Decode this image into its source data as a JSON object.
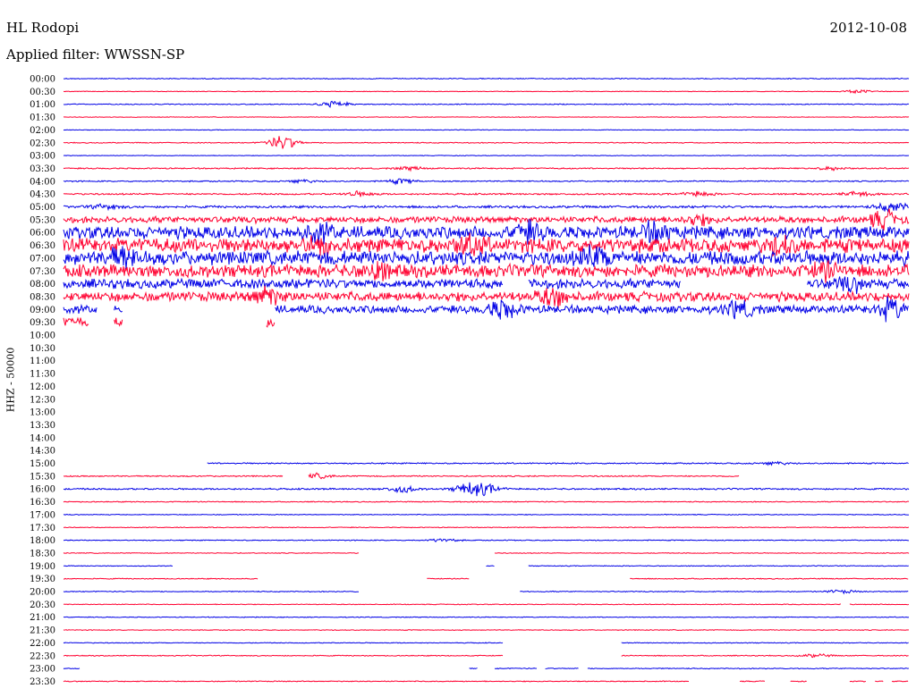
{
  "header": {
    "station": "HL Rodopi",
    "date": "2012-10-08",
    "filter": "Applied filter: WWSSN-SP"
  },
  "channel_label": "HHZ - 50000",
  "colors": {
    "odd": "#0000e6",
    "even": "#ff0030"
  },
  "chart_data": {
    "type": "line",
    "title": "HL Rodopi",
    "subtitle": "Applied filter: WWSSN-SP",
    "ylabel": "HHZ - 50000",
    "y_tick_labels": [
      "00:00",
      "00:30",
      "01:00",
      "01:30",
      "02:00",
      "02:30",
      "03:00",
      "03:30",
      "04:00",
      "04:30",
      "05:00",
      "05:30",
      "06:00",
      "06:30",
      "07:00",
      "07:30",
      "08:00",
      "08:30",
      "09:00",
      "09:30",
      "10:00",
      "10:30",
      "11:00",
      "11:30",
      "12:00",
      "12:30",
      "13:00",
      "13:30",
      "14:00",
      "14:30",
      "15:00",
      "15:30",
      "16:00",
      "16:30",
      "17:00",
      "17:30",
      "18:00",
      "18:30",
      "19:00",
      "19:30",
      "20:00",
      "20:30",
      "21:00",
      "21:30",
      "22:00",
      "22:30",
      "23:00",
      "23:30"
    ],
    "x_range_minutes": [
      0,
      30
    ],
    "series": [
      {
        "start": "00:00",
        "amplitude": 0.6,
        "segments": [
          [
            0,
            1
          ]
        ],
        "events": []
      },
      {
        "start": "00:30",
        "amplitude": 0.4,
        "segments": [
          [
            0,
            1
          ]
        ],
        "events": [
          [
            0.94,
            2
          ]
        ]
      },
      {
        "start": "01:00",
        "amplitude": 0.6,
        "segments": [
          [
            0,
            1
          ]
        ],
        "events": [
          [
            0.32,
            4
          ]
        ]
      },
      {
        "start": "01:30",
        "amplitude": 0.4,
        "segments": [
          [
            0,
            1
          ]
        ],
        "events": []
      },
      {
        "start": "02:00",
        "amplitude": 0.4,
        "segments": [
          [
            0,
            1
          ]
        ],
        "events": []
      },
      {
        "start": "02:30",
        "amplitude": 0.6,
        "segments": [
          [
            0,
            1
          ]
        ],
        "events": [
          [
            0.26,
            9
          ]
        ]
      },
      {
        "start": "03:00",
        "amplitude": 0.4,
        "segments": [
          [
            0,
            1
          ]
        ],
        "events": []
      },
      {
        "start": "03:30",
        "amplitude": 0.8,
        "segments": [
          [
            0,
            1
          ]
        ],
        "events": [
          [
            0.41,
            2
          ],
          [
            0.91,
            2
          ]
        ]
      },
      {
        "start": "04:00",
        "amplitude": 0.8,
        "segments": [
          [
            0,
            1
          ]
        ],
        "events": [
          [
            0.28,
            2
          ],
          [
            0.4,
            3
          ]
        ]
      },
      {
        "start": "04:30",
        "amplitude": 1.0,
        "segments": [
          [
            0,
            1
          ]
        ],
        "events": [
          [
            0.35,
            3
          ],
          [
            0.75,
            3
          ],
          [
            0.94,
            3
          ]
        ]
      },
      {
        "start": "05:00",
        "amplitude": 1.5,
        "segments": [
          [
            0,
            1
          ]
        ],
        "events": [
          [
            0.05,
            3
          ],
          [
            0.98,
            6
          ]
        ]
      },
      {
        "start": "05:30",
        "amplitude": 4,
        "segments": [
          [
            0,
            1
          ]
        ],
        "events": [
          [
            0.75,
            5
          ],
          [
            0.97,
            10
          ]
        ]
      },
      {
        "start": "06:00",
        "amplitude": 8,
        "segments": [
          [
            0,
            1
          ]
        ],
        "events": [
          [
            0.3,
            8
          ],
          [
            0.55,
            9
          ],
          [
            0.7,
            9
          ]
        ]
      },
      {
        "start": "06:30",
        "amplitude": 9,
        "segments": [
          [
            0,
            1
          ]
        ],
        "events": [
          [
            0.3,
            8
          ],
          [
            0.48,
            9
          ],
          [
            0.85,
            8
          ]
        ]
      },
      {
        "start": "07:00",
        "amplitude": 9,
        "segments": [
          [
            0,
            1
          ]
        ],
        "events": [
          [
            0.07,
            9
          ],
          [
            0.63,
            10
          ]
        ]
      },
      {
        "start": "07:30",
        "amplitude": 8,
        "segments": [
          [
            0,
            1
          ]
        ],
        "events": [
          [
            0.37,
            9
          ],
          [
            0.9,
            7
          ]
        ]
      },
      {
        "start": "08:00",
        "amplitude": 6,
        "segments": [
          [
            0,
            0.52
          ],
          [
            0.55,
            0.73
          ],
          [
            0.88,
            1
          ]
        ],
        "events": [
          [
            0.93,
            7
          ]
        ]
      },
      {
        "start": "08:30",
        "amplitude": 6,
        "segments": [
          [
            0,
            1
          ]
        ],
        "events": [
          [
            0.24,
            9
          ],
          [
            0.58,
            10
          ]
        ]
      },
      {
        "start": "09:00",
        "amplitude": 5,
        "segments": [
          [
            0,
            0.04
          ],
          [
            0.06,
            0.07
          ],
          [
            0.25,
            1
          ]
        ],
        "events": [
          [
            0.52,
            10
          ],
          [
            0.8,
            9
          ],
          [
            0.98,
            12
          ]
        ]
      },
      {
        "start": "09:30",
        "amplitude": 6,
        "segments": [
          [
            0,
            0.03
          ],
          [
            0.06,
            0.07
          ],
          [
            0.24,
            0.25
          ]
        ],
        "events": []
      },
      {
        "start": "10:00",
        "amplitude": 0,
        "segments": [],
        "events": []
      },
      {
        "start": "10:30",
        "amplitude": 0,
        "segments": [],
        "events": []
      },
      {
        "start": "11:00",
        "amplitude": 0,
        "segments": [],
        "events": []
      },
      {
        "start": "11:30",
        "amplitude": 0,
        "segments": [],
        "events": []
      },
      {
        "start": "12:00",
        "amplitude": 0,
        "segments": [],
        "events": []
      },
      {
        "start": "12:30",
        "amplitude": 0,
        "segments": [],
        "events": []
      },
      {
        "start": "13:00",
        "amplitude": 0,
        "segments": [],
        "events": []
      },
      {
        "start": "13:30",
        "amplitude": 0,
        "segments": [],
        "events": []
      },
      {
        "start": "14:00",
        "amplitude": 0,
        "segments": [],
        "events": []
      },
      {
        "start": "14:30",
        "amplitude": 0,
        "segments": [],
        "events": []
      },
      {
        "start": "15:00",
        "amplitude": 0.8,
        "segments": [
          [
            0.17,
            1
          ]
        ],
        "events": [
          [
            0.84,
            2
          ]
        ]
      },
      {
        "start": "15:30",
        "amplitude": 0.8,
        "segments": [
          [
            0,
            0.26
          ],
          [
            0.29,
            0.8
          ]
        ],
        "events": [
          [
            0.3,
            3
          ]
        ]
      },
      {
        "start": "16:00",
        "amplitude": 1.0,
        "segments": [
          [
            0,
            1
          ]
        ],
        "events": [
          [
            0.4,
            4
          ],
          [
            0.48,
            7
          ],
          [
            0.5,
            5
          ]
        ]
      },
      {
        "start": "16:30",
        "amplitude": 0.6,
        "segments": [
          [
            0,
            1
          ]
        ],
        "events": []
      },
      {
        "start": "17:00",
        "amplitude": 0.5,
        "segments": [
          [
            0,
            1
          ]
        ],
        "events": []
      },
      {
        "start": "17:30",
        "amplitude": 0.5,
        "segments": [
          [
            0,
            1
          ]
        ],
        "events": []
      },
      {
        "start": "18:00",
        "amplitude": 0.6,
        "segments": [
          [
            0,
            1
          ]
        ],
        "events": [
          [
            0.45,
            2
          ]
        ]
      },
      {
        "start": "18:30",
        "amplitude": 0.5,
        "segments": [
          [
            0,
            0.35
          ],
          [
            0.51,
            1
          ]
        ],
        "events": []
      },
      {
        "start": "19:00",
        "amplitude": 0.5,
        "segments": [
          [
            0,
            0.13
          ],
          [
            0.5,
            0.51
          ],
          [
            0.55,
            1
          ]
        ],
        "events": []
      },
      {
        "start": "19:30",
        "amplitude": 0.6,
        "segments": [
          [
            0,
            0.23
          ],
          [
            0.43,
            0.48
          ],
          [
            0.67,
            1
          ]
        ],
        "events": []
      },
      {
        "start": "20:00",
        "amplitude": 0.6,
        "segments": [
          [
            0,
            0.35
          ],
          [
            0.54,
            1
          ]
        ],
        "events": [
          [
            0.92,
            2
          ]
        ]
      },
      {
        "start": "20:30",
        "amplitude": 0.5,
        "segments": [
          [
            0,
            0.92
          ],
          [
            0.93,
            1
          ]
        ],
        "events": []
      },
      {
        "start": "21:00",
        "amplitude": 0.5,
        "segments": [
          [
            0,
            1
          ]
        ],
        "events": []
      },
      {
        "start": "21:30",
        "amplitude": 0.5,
        "segments": [
          [
            0,
            1
          ]
        ],
        "events": []
      },
      {
        "start": "22:00",
        "amplitude": 0.5,
        "segments": [
          [
            0,
            0.52
          ],
          [
            0.66,
            1
          ]
        ],
        "events": []
      },
      {
        "start": "22:30",
        "amplitude": 0.6,
        "segments": [
          [
            0,
            0.52
          ],
          [
            0.66,
            1
          ]
        ],
        "events": [
          [
            0.89,
            2
          ]
        ]
      },
      {
        "start": "23:00",
        "amplitude": 0.6,
        "segments": [
          [
            0,
            0.02
          ],
          [
            0.48,
            0.49
          ],
          [
            0.51,
            0.56
          ],
          [
            0.57,
            0.61
          ],
          [
            0.62,
            1
          ]
        ],
        "events": []
      },
      {
        "start": "23:30",
        "amplitude": 0.6,
        "segments": [
          [
            0,
            0.74
          ],
          [
            0.8,
            0.83
          ],
          [
            0.86,
            0.88
          ],
          [
            0.93,
            0.95
          ],
          [
            0.96,
            0.97
          ],
          [
            0.98,
            1
          ]
        ],
        "events": []
      }
    ],
    "grid": false
  }
}
